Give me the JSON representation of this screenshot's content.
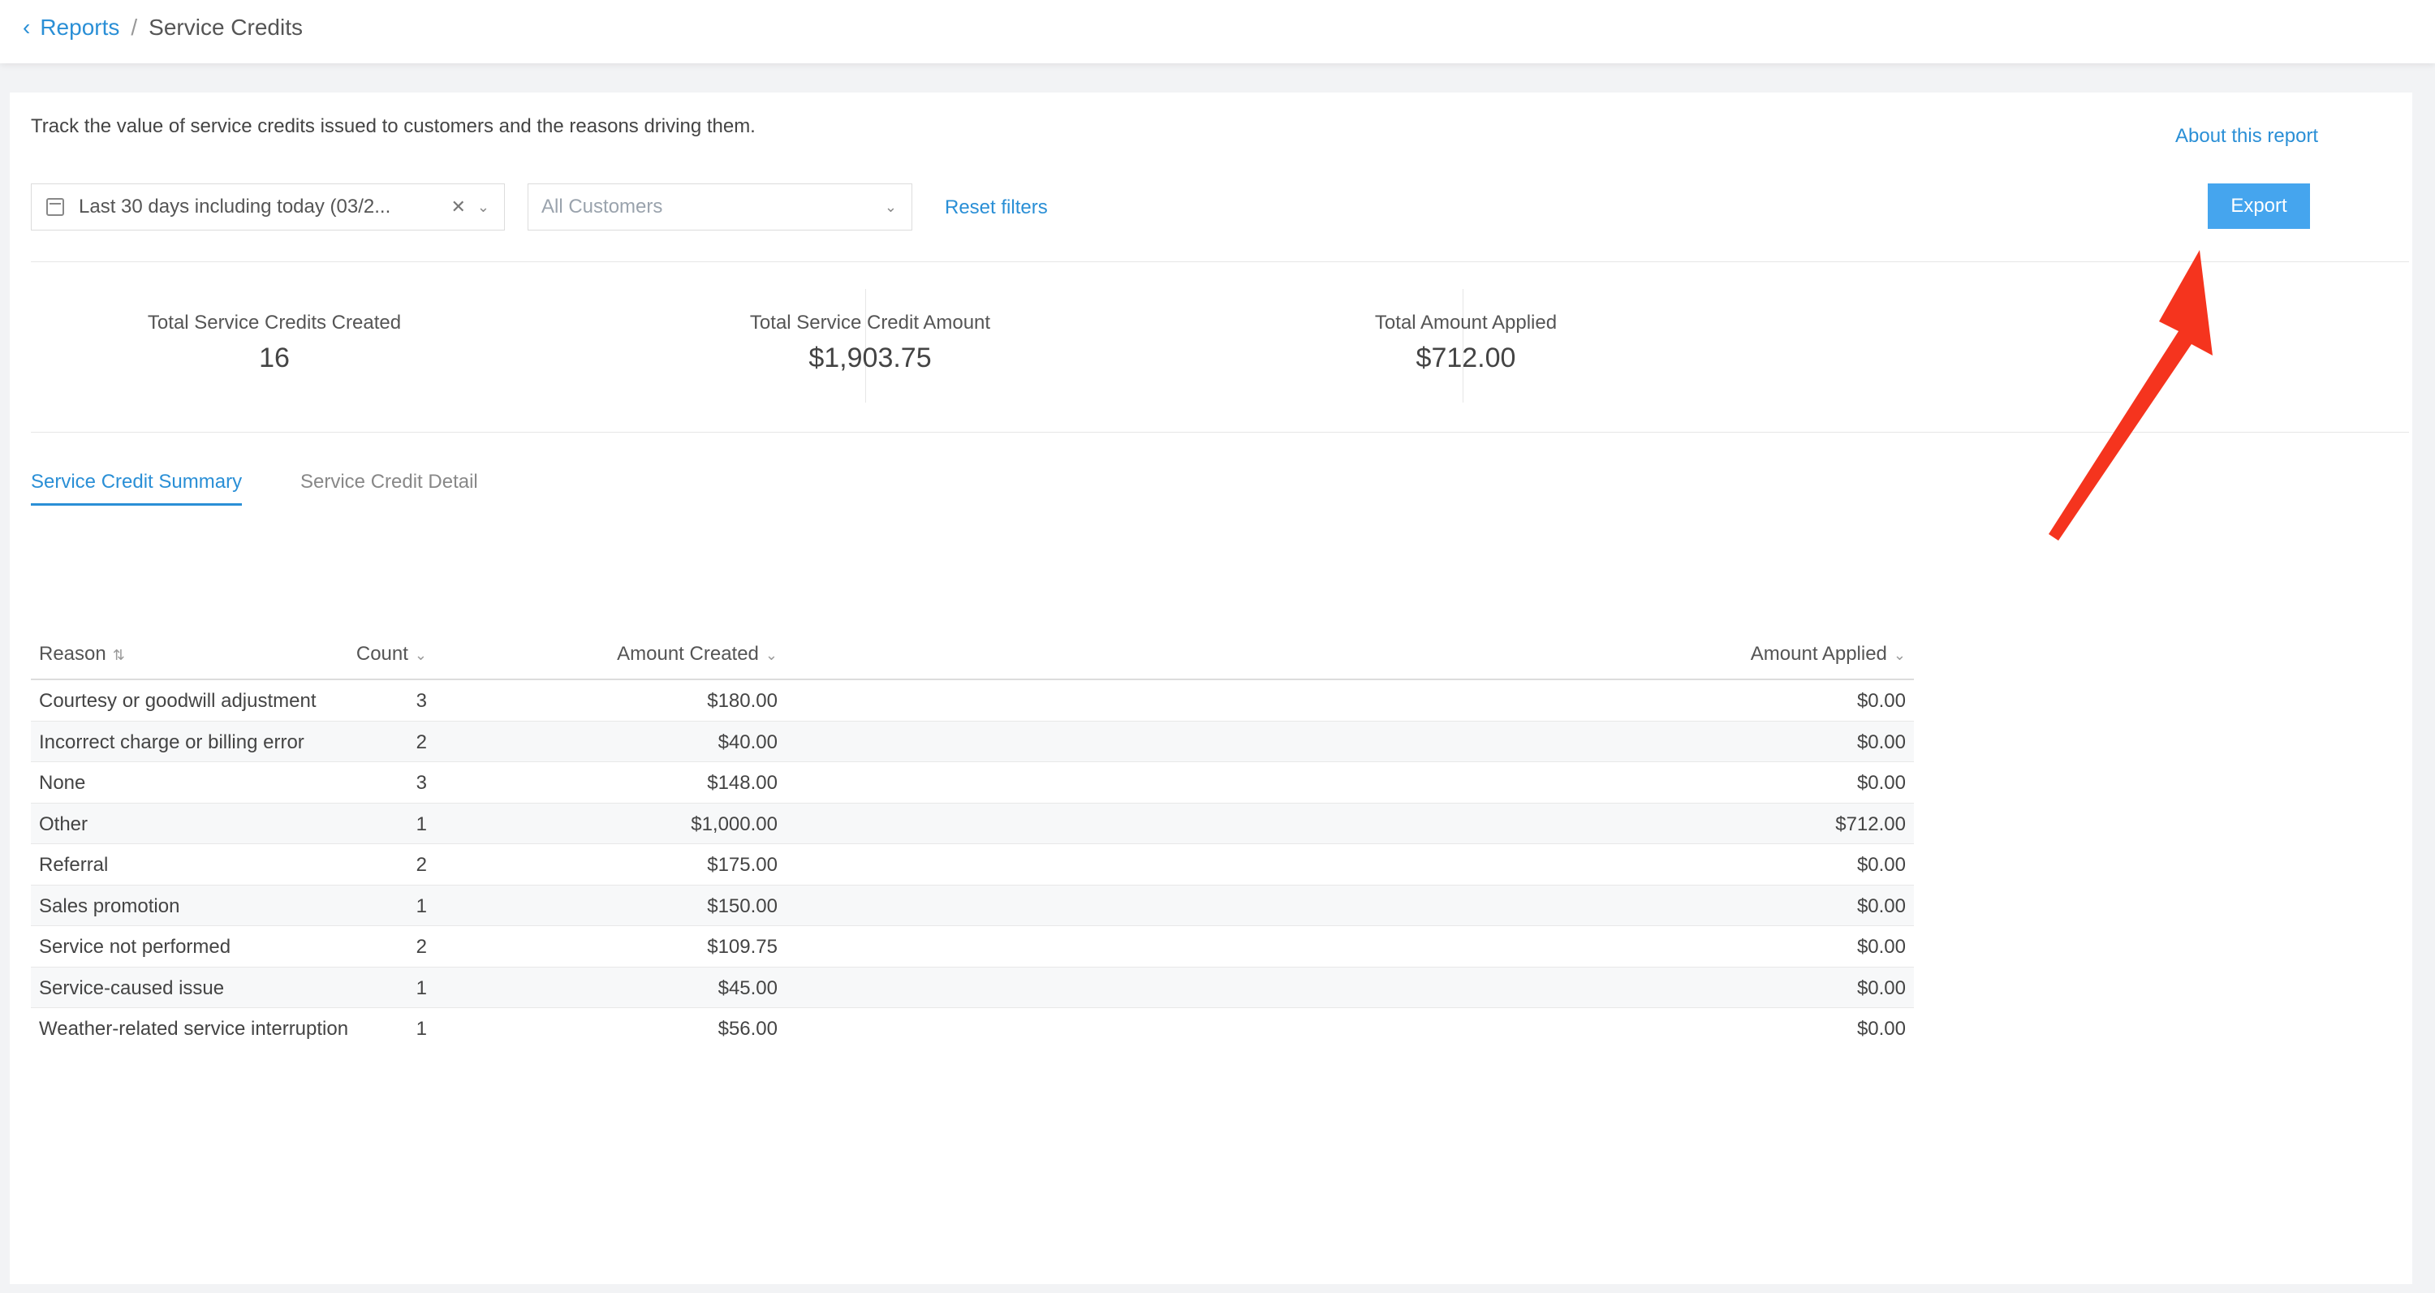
{
  "breadcrumb": {
    "parent": "Reports",
    "separator": "/",
    "current": "Service Credits"
  },
  "description": "Track the value of service credits issued to customers and the reasons driving them.",
  "about_link": "About this report",
  "filters": {
    "date_range": "Last 30 days including today (03/2...",
    "customers_placeholder": "All Customers",
    "reset_label": "Reset filters"
  },
  "export_label": "Export",
  "stats": [
    {
      "label": "Total Service Credits Created",
      "value": "16"
    },
    {
      "label": "Total Service Credit Amount",
      "value": "$1,903.75"
    },
    {
      "label": "Total Amount Applied",
      "value": "$712.00"
    }
  ],
  "tabs": [
    {
      "label": "Service Credit Summary",
      "active": true
    },
    {
      "label": "Service Credit Detail",
      "active": false
    }
  ],
  "table": {
    "columns": [
      "Reason",
      "Count",
      "Amount Created",
      "Amount Applied"
    ],
    "rows": [
      {
        "reason": "Courtesy or goodwill adjustment",
        "count": "3",
        "created": "$180.00",
        "applied": "$0.00"
      },
      {
        "reason": "Incorrect charge or billing error",
        "count": "2",
        "created": "$40.00",
        "applied": "$0.00"
      },
      {
        "reason": "None",
        "count": "3",
        "created": "$148.00",
        "applied": "$0.00"
      },
      {
        "reason": "Other",
        "count": "1",
        "created": "$1,000.00",
        "applied": "$712.00"
      },
      {
        "reason": "Referral",
        "count": "2",
        "created": "$175.00",
        "applied": "$0.00"
      },
      {
        "reason": "Sales promotion",
        "count": "1",
        "created": "$150.00",
        "applied": "$0.00"
      },
      {
        "reason": "Service not performed",
        "count": "2",
        "created": "$109.75",
        "applied": "$0.00"
      },
      {
        "reason": "Service-caused issue",
        "count": "1",
        "created": "$45.00",
        "applied": "$0.00"
      },
      {
        "reason": "Weather-related service interruption",
        "count": "1",
        "created": "$56.00",
        "applied": "$0.00"
      }
    ]
  },
  "colors": {
    "accent": "#2a8fd6",
    "export_button": "#45a5ee",
    "annotation_arrow": "#f5341e"
  },
  "icons": {
    "back": "chevron-left-icon",
    "calendar": "calendar-icon",
    "clear": "close-icon",
    "dropdown": "chevron-down-icon",
    "sort": "sort-icon"
  }
}
